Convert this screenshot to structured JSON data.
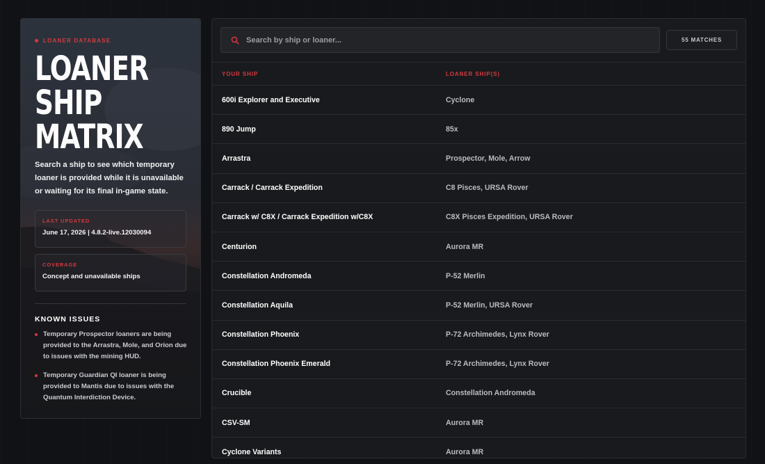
{
  "sidebar": {
    "eyebrow": "LOANER DATABASE",
    "title_lines": [
      "LOANER",
      "SHIP",
      "MATRIX"
    ],
    "description": "Search a ship to see which temporary loaner is provided while it is unavailable or waiting for its final in-game state.",
    "last_updated": {
      "label": "LAST UPDATED",
      "value": "June 17, 2026 | 4.8.2-live.12030094"
    },
    "coverage": {
      "label": "COVERAGE",
      "value": "Concept and unavailable ships"
    },
    "known_issues": {
      "title": "KNOWN ISSUES",
      "items": [
        "Temporary Prospector loaners are being provided to the Arrastra, Mole, and Orion due to issues with the mining HUD.",
        "Temporary Guardian QI loaner is being provided to Mantis due to issues with the Quantum Interdiction Device."
      ]
    }
  },
  "search": {
    "placeholder": "Search by ship or loaner...",
    "value": "",
    "icon": "search-icon"
  },
  "matches_label": "55 MATCHES",
  "table": {
    "headers": [
      "YOUR SHIP",
      "LOANER SHIP(S)"
    ],
    "rows": [
      [
        "600i Explorer and Executive",
        "Cyclone"
      ],
      [
        "890 Jump",
        "85x"
      ],
      [
        "Arrastra",
        "Prospector, Mole, Arrow"
      ],
      [
        "Carrack / Carrack Expedition",
        "C8 Pisces, URSA Rover"
      ],
      [
        "Carrack w/ C8X / Carrack Expedition w/C8X",
        "C8X Pisces Expedition, URSA Rover"
      ],
      [
        "Centurion",
        "Aurora MR"
      ],
      [
        "Constellation Andromeda",
        "P-52 Merlin"
      ],
      [
        "Constellation Aquila",
        "P-52 Merlin, URSA Rover"
      ],
      [
        "Constellation Phoenix",
        "P-72 Archimedes, Lynx Rover"
      ],
      [
        "Constellation Phoenix Emerald",
        "P-72 Archimedes, Lynx Rover"
      ],
      [
        "Crucible",
        "Constellation Andromeda"
      ],
      [
        "CSV-SM",
        "Aurora MR"
      ],
      [
        "Cyclone Variants",
        "Aurora MR"
      ]
    ]
  },
  "colors": {
    "accent": "#d8373d",
    "background": "#111215",
    "panel": "#191a1d"
  }
}
